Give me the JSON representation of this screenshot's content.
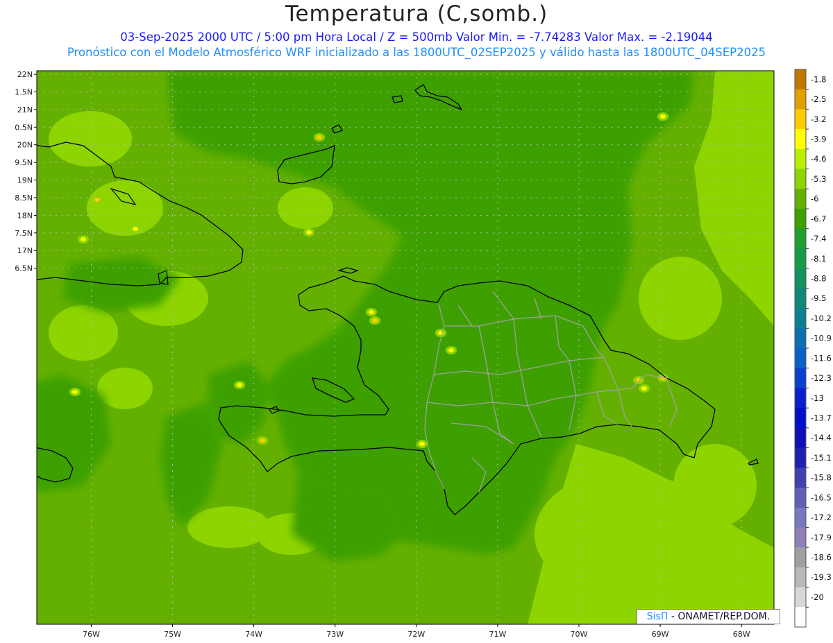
{
  "title": "Temperatura (C,somb.)",
  "subtitle_line1": "03-Sep-2025  2000 UTC / 5:00 pm Hora Local / Z = 500mb  Valor Min. = -7.74283  Valor Max. = -2.19044",
  "subtitle_line2": "Pronóstico con el Modelo Atmosférico WRF inicializado a las 1800UTC_02SEP2025 y válido hasta las  1800UTC_04SEP2025",
  "map": {
    "lon_range": [
      -76.67,
      -67.6
    ],
    "lat_range": [
      6.4,
      22.1
    ],
    "lat_ticks": [
      {
        "value": 22,
        "label": "22N"
      },
      {
        "value": 21.5,
        "label": "1.5N"
      },
      {
        "value": 21,
        "label": "21N"
      },
      {
        "value": 20.5,
        "label": "0.5N"
      },
      {
        "value": 20,
        "label": "20N"
      },
      {
        "value": 19.5,
        "label": "9.5N"
      },
      {
        "value": 19,
        "label": "19N"
      },
      {
        "value": 18.5,
        "label": "8.5N"
      },
      {
        "value": 18,
        "label": "18N"
      },
      {
        "value": 17.5,
        "label": "7.5N"
      },
      {
        "value": 17,
        "label": "17N"
      },
      {
        "value": 16.5,
        "label": "6.5N"
      }
    ],
    "lon_ticks": [
      {
        "value": -76,
        "label": "76W"
      },
      {
        "value": -75,
        "label": "75W"
      },
      {
        "value": -74,
        "label": "74W"
      },
      {
        "value": -73,
        "label": "73W"
      },
      {
        "value": -72,
        "label": "72W"
      },
      {
        "value": -71,
        "label": "71W"
      },
      {
        "value": -70,
        "label": "70W"
      },
      {
        "value": -69,
        "label": "69W"
      },
      {
        "value": -68,
        "label": "68W"
      }
    ],
    "colors": {
      "base_light": "#8ed400",
      "mid": "#64b000",
      "dark": "#3da000",
      "coast": "#000000",
      "province": "#a0a0a0",
      "grid": "#b8b8b8"
    }
  },
  "colorbar": {
    "labels": [
      "-1.8",
      "-2.5",
      "-3.2",
      "-3.9",
      "-4.6",
      "-5.3",
      "-6",
      "-6.7",
      "-7.4",
      "-8.1",
      "-8.8",
      "-9.5",
      "-10.2",
      "-10.9",
      "-11.6",
      "-12.3",
      "-13",
      "-13.7",
      "-14.4",
      "-15.1",
      "-15.8",
      "-16.5",
      "-17.2",
      "-17.9",
      "-18.6",
      "-19.3",
      "-20"
    ],
    "colors": [
      "#c07800",
      "#e0a000",
      "#ffcc00",
      "#ffff00",
      "#b8f000",
      "#8ed400",
      "#64b000",
      "#3da000",
      "#1ea030",
      "#1a9a48",
      "#159060",
      "#108878",
      "#0c8090",
      "#0a70b0",
      "#0a60c8",
      "#0a40d0",
      "#0a20d0",
      "#0010c8",
      "#1010b8",
      "#2020b0",
      "#4040b0",
      "#6060b8",
      "#7878c0",
      "#9080b8",
      "#a0a0a0",
      "#b8b8b8",
      "#d8d8d8",
      "#ffffff"
    ]
  },
  "credit": {
    "brand": "SisΠ",
    "text": " - ONAMET/REP.DOM."
  }
}
